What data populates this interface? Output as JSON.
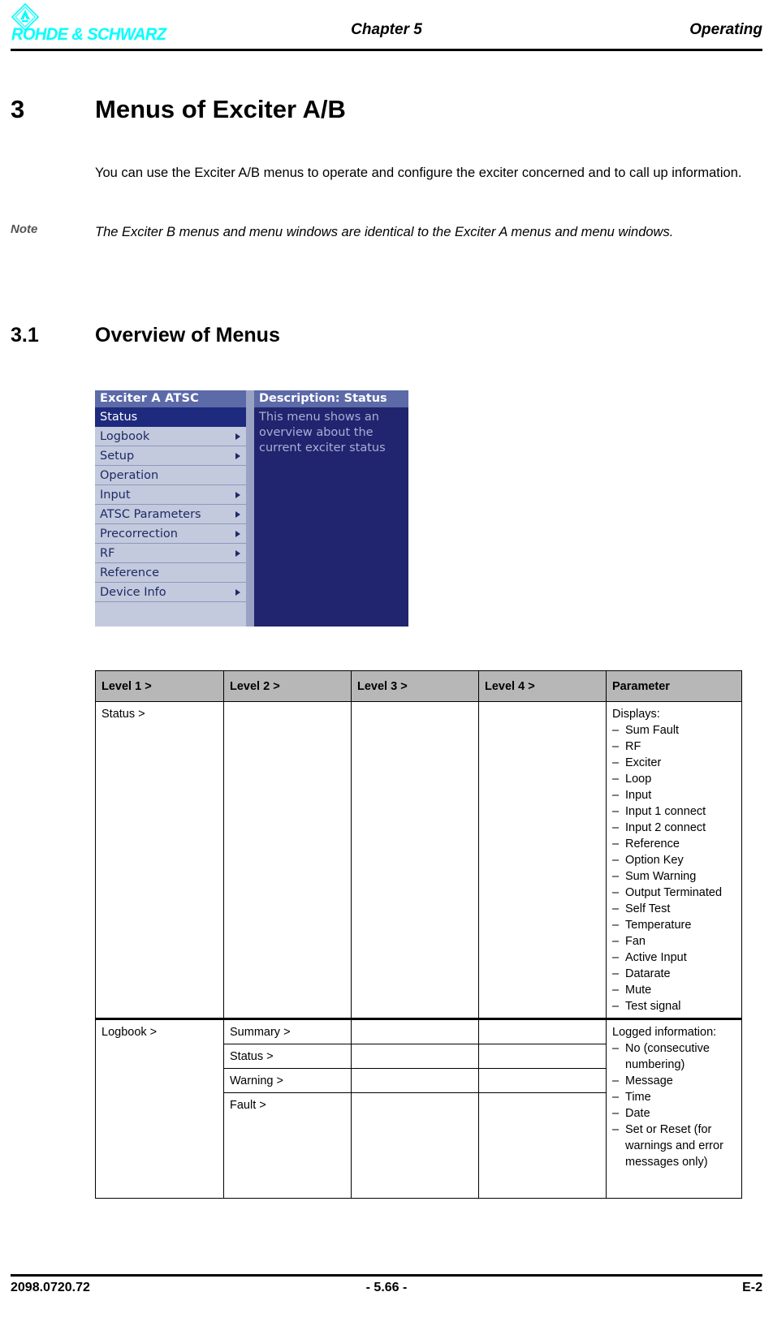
{
  "header": {
    "logo_text": "ROHDE & SCHWARZ",
    "logo_icon": "rs-diamond-logo-icon",
    "chapter": "Chapter 5",
    "section": "Operating",
    "logo_color": "#00ffff"
  },
  "content": {
    "h1_number": "3",
    "h1_title": "Menus of Exciter A/B",
    "intro": "You can use the Exciter A/B menus to operate and configure the exciter concerned and to call up information.",
    "note_label": "Note",
    "note_text": "The Exciter B menus and menu windows are identical to the Exciter A menus and menu windows.",
    "h2_number": "3.1",
    "h2_title": "Overview of Menus"
  },
  "menu_screenshot": {
    "title": "Exciter A ATSC",
    "items": [
      {
        "label": "Status",
        "selected": true,
        "has_arrow": false
      },
      {
        "label": "Logbook",
        "selected": false,
        "has_arrow": true
      },
      {
        "label": "Setup",
        "selected": false,
        "has_arrow": true
      },
      {
        "label": "Operation",
        "selected": false,
        "has_arrow": false
      },
      {
        "label": "Input",
        "selected": false,
        "has_arrow": true
      },
      {
        "label": "ATSC Parameters",
        "selected": false,
        "has_arrow": true
      },
      {
        "label": "Precorrection",
        "selected": false,
        "has_arrow": true
      },
      {
        "label": "RF",
        "selected": false,
        "has_arrow": true
      },
      {
        "label": "Reference",
        "selected": false,
        "has_arrow": false
      },
      {
        "label": "Device Info",
        "selected": false,
        "has_arrow": true
      }
    ],
    "description_title": "Description: Status",
    "description_body": "This menu shows an overview about the current exciter status",
    "colors": {
      "titlebar": "#5c6aa8",
      "menu_background": "#c3cade",
      "selected_row": "#1d2a7e",
      "description_panel": "#21246e",
      "description_text": "#a8b0d4"
    }
  },
  "table": {
    "headers": [
      "Level 1 >",
      "Level 2 >",
      "Level 3 >",
      "Level 4 >",
      "Parameter"
    ],
    "header_background": "#b7b7b7",
    "rows": [
      {
        "level1": "Status >",
        "level2": "",
        "level3": "",
        "level4": "",
        "parameter_intro": "Displays:",
        "parameter_items": [
          "Sum Fault",
          "RF",
          "Exciter",
          "Loop",
          "Input",
          "Input 1 connect",
          "Input 2 connect",
          "Reference",
          "Option Key",
          "Sum Warning",
          "Output Terminated",
          "Self Test",
          "Temperature",
          "Fan",
          "Active Input",
          "Datarate",
          "Mute",
          "Test signal"
        ]
      },
      {
        "level1": "Logbook >",
        "sub_rows": [
          "Summary >",
          "Status >",
          "Warning >",
          "Fault >"
        ],
        "parameter_intro": "Logged information:",
        "parameter_items": [
          "No (consecutive numbering)",
          "Message",
          "Time",
          "Date",
          "Set or Reset (for warnings and error messages only)"
        ]
      }
    ]
  },
  "footer": {
    "left": "2098.0720.72",
    "center": "- 5.66 -",
    "right": "E-2"
  }
}
